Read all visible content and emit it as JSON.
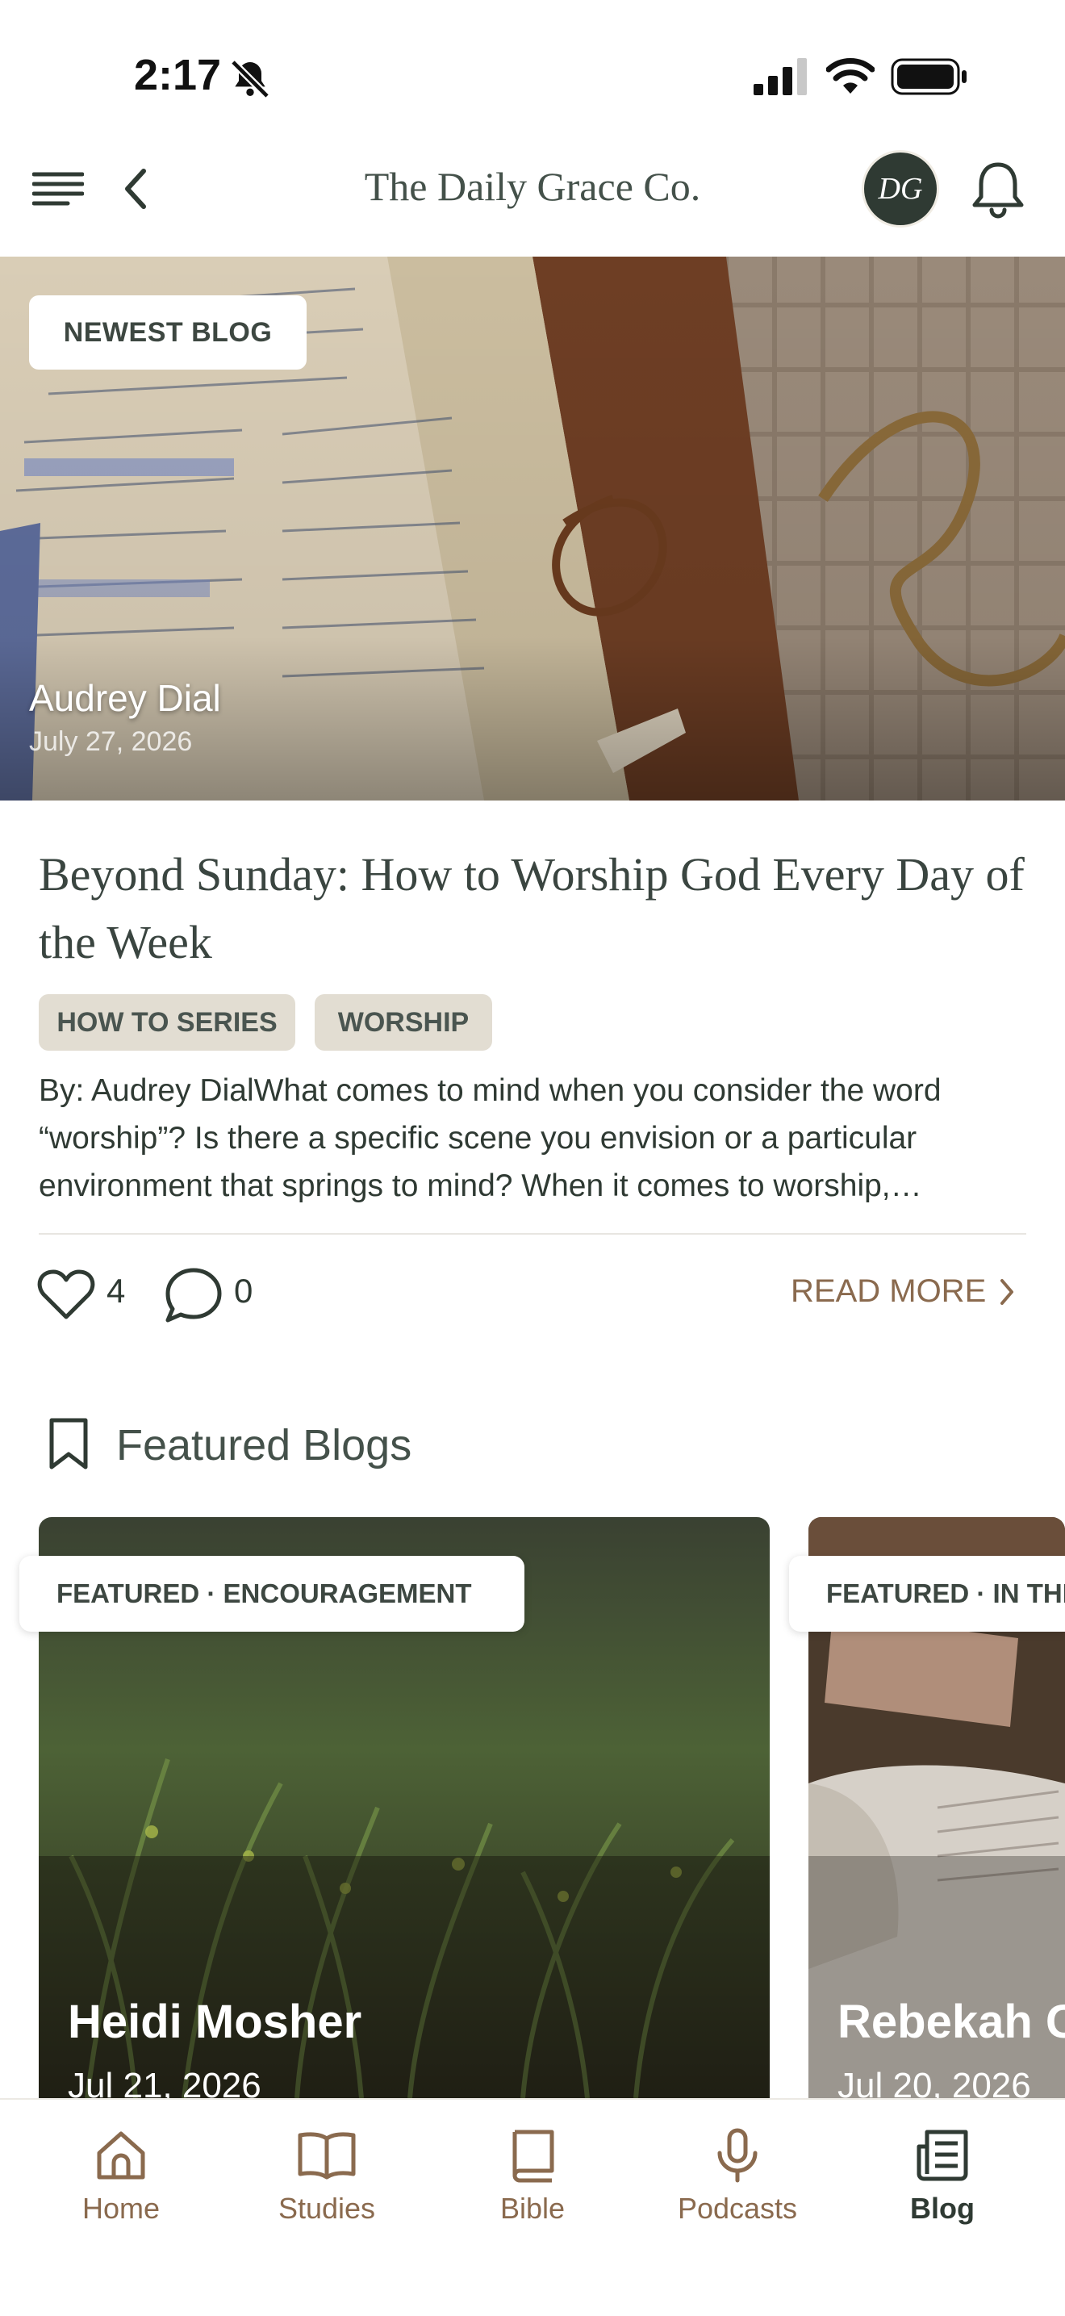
{
  "status_bar": {
    "time": "2:17"
  },
  "header": {
    "title": "The Daily Grace Co.",
    "avatar_initials": "DG"
  },
  "hero": {
    "badge": "NEWEST BLOG",
    "author": "Audrey Dial",
    "date": "July 27, 2026"
  },
  "article": {
    "title": "Beyond Sunday: How to Worship God Every Day of the Week",
    "tags": [
      "HOW TO SERIES",
      "WORSHIP"
    ],
    "excerpt": "By: Audrey DialWhat comes to mind when you consider the word “worship”? Is there a specific scene you envision or a particular environment that springs to mind? When it comes to worship,…",
    "likes": "4",
    "comments": "0",
    "read_more": "READ MORE"
  },
  "featured": {
    "heading": "Featured Blogs",
    "cards": [
      {
        "badge": "FEATURED · ENCOURAGEMENT",
        "author": "Heidi Mosher",
        "date": "Jul 21, 2026"
      },
      {
        "badge": "FEATURED · IN THE WORD",
        "author": "Rebekah Griffin",
        "date": "Jul 20, 2026"
      }
    ]
  },
  "tabbar": {
    "items": [
      {
        "label": "Home",
        "icon": "home-icon"
      },
      {
        "label": "Studies",
        "icon": "book-open-icon"
      },
      {
        "label": "Bible",
        "icon": "bible-icon"
      },
      {
        "label": "Podcasts",
        "icon": "microphone-icon"
      },
      {
        "label": "Blog",
        "icon": "newspaper-icon",
        "active": true
      }
    ]
  },
  "colors": {
    "accent_brown": "#8a6a4e",
    "dark_green": "#2f3a33",
    "tag_bg": "#e2ddd2"
  }
}
